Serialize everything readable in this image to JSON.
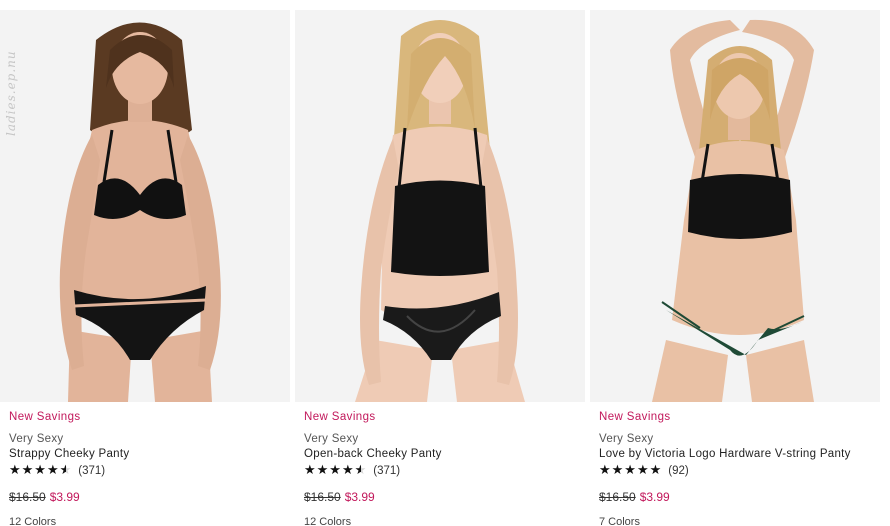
{
  "watermark": "ladies.ep.nu",
  "products": [
    {
      "badge": "New Savings",
      "brand": "Very Sexy",
      "name": "Strappy Cheeky Panty",
      "rating": 4.5,
      "review_count": "(371)",
      "was_price": "$16.50",
      "sale_price": "$3.99",
      "image_alt": "model in black satin bra and black strappy cheeky panty",
      "colors": "12 Colors",
      "image_colors": {
        "hair": "#5a3a22",
        "skin": "#e2b49a",
        "top": "#111111",
        "bottom": "#141414"
      }
    },
    {
      "badge": "New Savings",
      "brand": "Very Sexy",
      "name": "Open-back Cheeky Panty",
      "rating": 4.5,
      "review_count": "(371)",
      "was_price": "$16.50",
      "sale_price": "$3.99",
      "image_alt": "model in black crop cami and black mesh open-back cheeky panty",
      "colors": "12 Colors",
      "image_colors": {
        "hair": "#d9b77c",
        "skin": "#efcbb5",
        "top": "#131313",
        "bottom": "#1a1a1a"
      }
    },
    {
      "badge": "New Savings",
      "brand": "Very Sexy",
      "name": "Love by Victoria Logo Hardware V-string Panty",
      "rating": 5,
      "review_count": "(92)",
      "was_price": "$16.50",
      "sale_price": "$3.99",
      "image_alt": "model in black crop top and green v-string panty",
      "colors": "7 Colors",
      "image_colors": {
        "hair": "#d4ad72",
        "skin": "#e9c1a5",
        "top": "#121212",
        "bottom": "#1f4a36"
      }
    }
  ]
}
